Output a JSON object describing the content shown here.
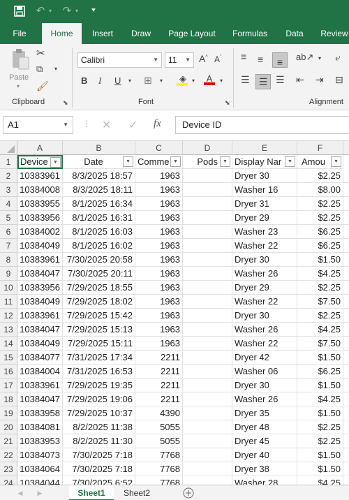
{
  "ribbon_tabs": [
    "File",
    "Home",
    "Insert",
    "Draw",
    "Page Layout",
    "Formulas",
    "Data",
    "Review"
  ],
  "ribbon": {
    "paste_label": "Paste",
    "font_name": "Calibri",
    "font_size": "11",
    "groups": {
      "clipboard": "Clipboard",
      "font": "Font",
      "alignment": "Alignment"
    }
  },
  "formula_bar": {
    "name_box": "A1",
    "content": "Device ID"
  },
  "columns": [
    "A",
    "B",
    "C",
    "D",
    "E",
    "F"
  ],
  "headers": [
    "Device",
    "Date",
    "Comme",
    "Pods",
    "Display Nar",
    "Amou"
  ],
  "rows": [
    {
      "n": "2",
      "a": "10383961",
      "b": "8/3/2025 18:57",
      "c": "1963",
      "d": "",
      "e": "Dryer 30",
      "f": "$2.25"
    },
    {
      "n": "3",
      "a": "10384008",
      "b": "8/3/2025 18:11",
      "c": "1963",
      "d": "",
      "e": "Washer 16",
      "f": "$8.00"
    },
    {
      "n": "4",
      "a": "10383955",
      "b": "8/1/2025 16:34",
      "c": "1963",
      "d": "",
      "e": "Dryer 31",
      "f": "$2.25"
    },
    {
      "n": "5",
      "a": "10383956",
      "b": "8/1/2025 16:31",
      "c": "1963",
      "d": "",
      "e": "Dryer 29",
      "f": "$2.25"
    },
    {
      "n": "6",
      "a": "10384002",
      "b": "8/1/2025 16:03",
      "c": "1963",
      "d": "",
      "e": "Washer 23",
      "f": "$6.25"
    },
    {
      "n": "7",
      "a": "10384049",
      "b": "8/1/2025 16:02",
      "c": "1963",
      "d": "",
      "e": "Washer 22",
      "f": "$6.25"
    },
    {
      "n": "8",
      "a": "10383961",
      "b": "7/30/2025 20:58",
      "c": "1963",
      "d": "",
      "e": "Dryer 30",
      "f": "$1.50"
    },
    {
      "n": "9",
      "a": "10384047",
      "b": "7/30/2025 20:11",
      "c": "1963",
      "d": "",
      "e": "Washer 26",
      "f": "$4.25"
    },
    {
      "n": "10",
      "a": "10383956",
      "b": "7/29/2025 18:55",
      "c": "1963",
      "d": "",
      "e": "Dryer 29",
      "f": "$2.25"
    },
    {
      "n": "11",
      "a": "10384049",
      "b": "7/29/2025 18:02",
      "c": "1963",
      "d": "",
      "e": "Washer 22",
      "f": "$7.50"
    },
    {
      "n": "12",
      "a": "10383961",
      "b": "7/29/2025 15:42",
      "c": "1963",
      "d": "",
      "e": "Dryer 30",
      "f": "$2.25"
    },
    {
      "n": "13",
      "a": "10384047",
      "b": "7/29/2025 15:13",
      "c": "1963",
      "d": "",
      "e": "Washer 26",
      "f": "$4.25"
    },
    {
      "n": "14",
      "a": "10384049",
      "b": "7/29/2025 15:11",
      "c": "1963",
      "d": "",
      "e": "Washer 22",
      "f": "$7.50"
    },
    {
      "n": "15",
      "a": "10384077",
      "b": "7/31/2025 17:34",
      "c": "2211",
      "d": "",
      "e": "Dryer 42",
      "f": "$1.50"
    },
    {
      "n": "16",
      "a": "10384004",
      "b": "7/31/2025 16:53",
      "c": "2211",
      "d": "",
      "e": "Washer 06",
      "f": "$6.25"
    },
    {
      "n": "17",
      "a": "10383961",
      "b": "7/29/2025 19:35",
      "c": "2211",
      "d": "",
      "e": "Dryer 30",
      "f": "$1.50"
    },
    {
      "n": "18",
      "a": "10384047",
      "b": "7/29/2025 19:06",
      "c": "2211",
      "d": "",
      "e": "Washer 26",
      "f": "$4.25"
    },
    {
      "n": "19",
      "a": "10383958",
      "b": "7/29/2025 10:37",
      "c": "4390",
      "d": "",
      "e": "Dryer 35",
      "f": "$1.50"
    },
    {
      "n": "20",
      "a": "10384081",
      "b": "8/2/2025 11:38",
      "c": "5055",
      "d": "",
      "e": "Dryer 48",
      "f": "$2.25"
    },
    {
      "n": "21",
      "a": "10383953",
      "b": "8/2/2025 11:30",
      "c": "5055",
      "d": "",
      "e": "Dryer 45",
      "f": "$2.25"
    },
    {
      "n": "22",
      "a": "10384073",
      "b": "7/30/2025 7:18",
      "c": "7768",
      "d": "",
      "e": "Dryer 40",
      "f": "$1.50"
    },
    {
      "n": "23",
      "a": "10384064",
      "b": "7/30/2025 7:18",
      "c": "7768",
      "d": "",
      "e": "Dryer 38",
      "f": "$1.50"
    },
    {
      "n": "24",
      "a": "10384044",
      "b": "7/30/2025 6:52",
      "c": "7768",
      "d": "",
      "e": "Washer 28",
      "f": "$4.25"
    }
  ],
  "sheets": [
    "Sheet1",
    "Sheet2"
  ],
  "colors": {
    "accent": "#217346"
  }
}
